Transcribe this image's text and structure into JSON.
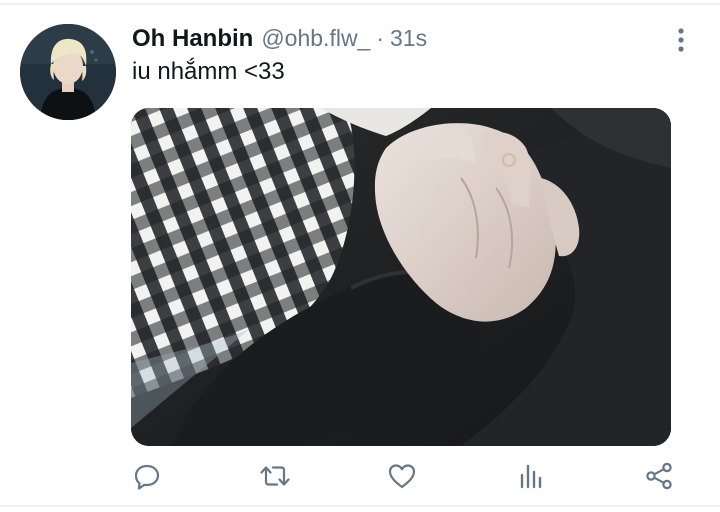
{
  "tweet": {
    "display_name": "Oh Hanbin",
    "handle": "@ohb.flw_",
    "separator": "·",
    "time": "31s",
    "text": "iu nhắmm <33"
  },
  "icons": {
    "more": "more-vertical-icon",
    "reply": "reply-icon",
    "retweet": "retweet-icon",
    "like": "like-icon",
    "analytics": "analytics-icon",
    "share": "share-icon"
  },
  "colors": {
    "text_primary": "#14171a",
    "text_secondary": "#657786",
    "icon": "#657786",
    "divider": "#eef0f2"
  }
}
